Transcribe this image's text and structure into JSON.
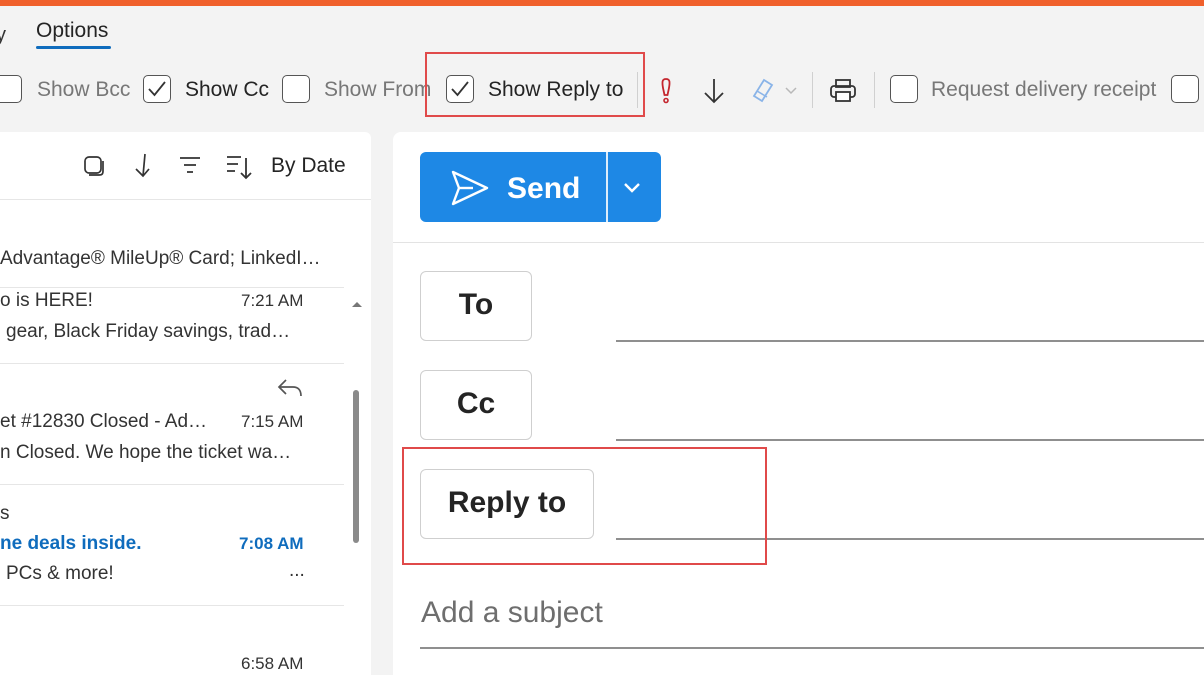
{
  "tabs": {
    "partial_tab": "y",
    "active_tab": "Options"
  },
  "ribbon": {
    "show_bcc": {
      "label": "Show Bcc",
      "checked": false
    },
    "show_cc": {
      "label": "Show Cc",
      "checked": true
    },
    "show_from": {
      "label": "Show From",
      "checked": false
    },
    "show_reply_to": {
      "label": "Show Reply to",
      "checked": true
    },
    "request_delivery_receipt": {
      "label": "Request delivery receipt",
      "checked": false
    },
    "icons": [
      "importance-icon",
      "low-importance-icon",
      "sensitivity-icon",
      "print-icon"
    ]
  },
  "list": {
    "sort_label": "By Date",
    "items": [
      {
        "preview": "Advantage® MileUp® Card; LinkedI…"
      },
      {
        "subject": "o is HERE!",
        "time": "7:21 AM",
        "preview": "gear, Black Friday savings, trad…"
      },
      {
        "subject": "et #12830 Closed - Ad…",
        "time": "7:15 AM",
        "preview": "n Closed. We hope the ticket wa…",
        "replied": true
      },
      {
        "sender": "s",
        "subject": "ne deals inside.",
        "time": "7:08 AM",
        "preview": "PCs & more!",
        "more": "...",
        "unread": true
      },
      {
        "time": "6:58 AM"
      }
    ]
  },
  "compose": {
    "send_label": "Send",
    "to_label": "To",
    "cc_label": "Cc",
    "reply_to_label": "Reply to",
    "subject_placeholder": "Add a subject"
  },
  "colors": {
    "accent": "#f0602b",
    "send": "#1e88e5",
    "highlight": "#e04a4a",
    "link": "#0f6cbd"
  }
}
